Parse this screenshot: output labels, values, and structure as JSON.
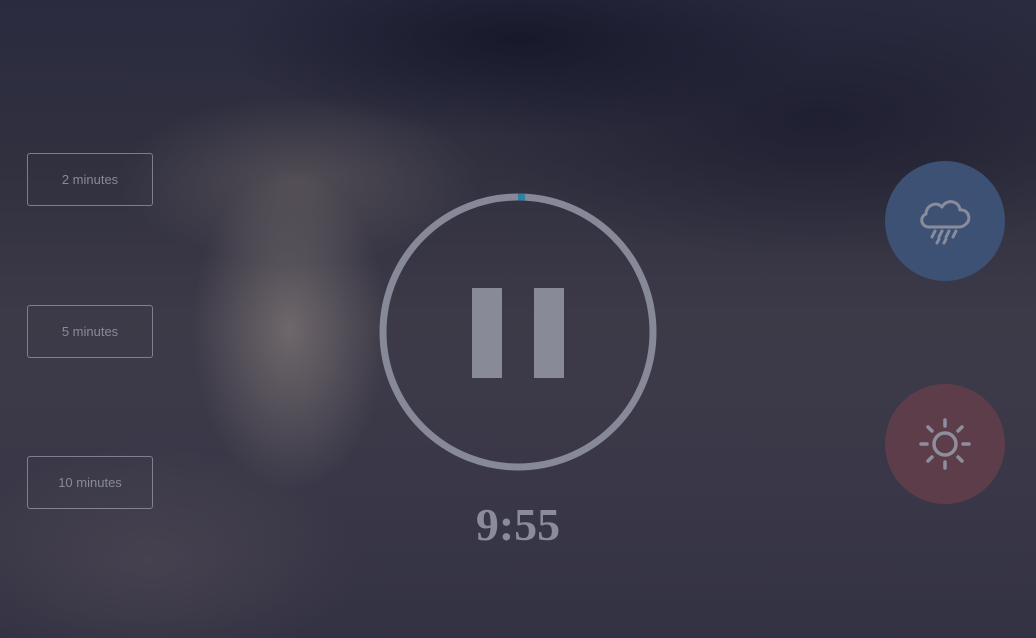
{
  "presets": [
    {
      "label": "2 minutes"
    },
    {
      "label": "5 minutes"
    },
    {
      "label": "10 minutes"
    }
  ],
  "timer": {
    "display": "9:55",
    "state": "playing",
    "control_icon": "pause-icon",
    "progress_fraction": 0.0083
  },
  "sounds": [
    {
      "icon": "rain-cloud-icon",
      "color": "#3c5174"
    },
    {
      "icon": "sun-icon",
      "color": "#5e3d4a"
    }
  ],
  "colors": {
    "ring": "#878998",
    "progress": "#2f7fa6",
    "text": "#8a8c9b"
  }
}
